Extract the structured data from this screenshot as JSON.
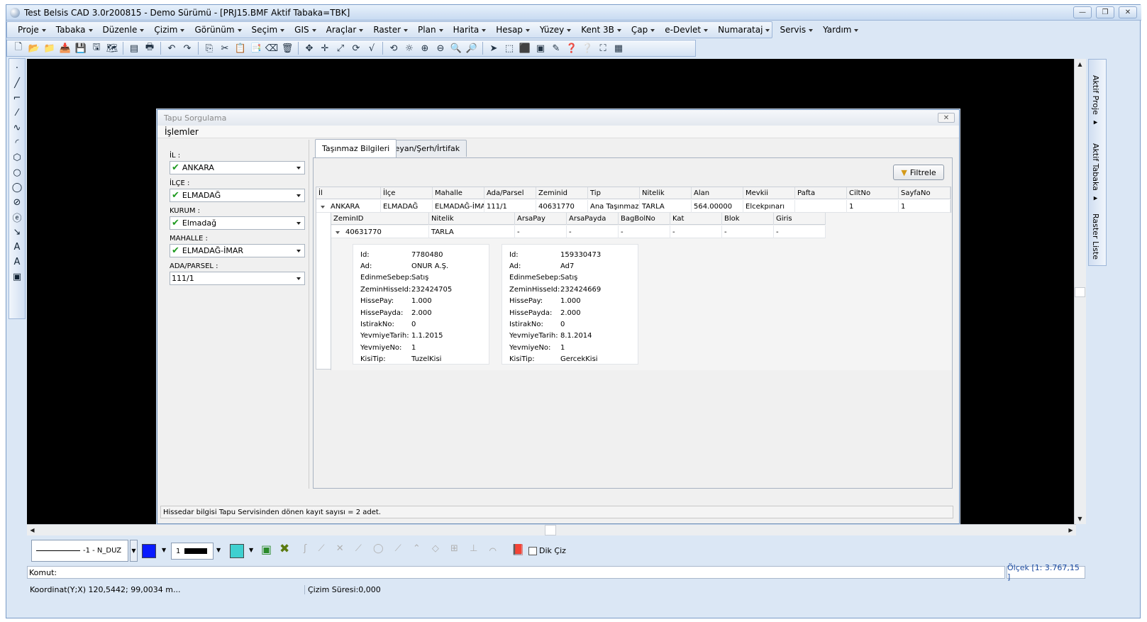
{
  "window": {
    "title": "Test Belsis CAD 3.0r200815 - Demo Sürümü - [PRJ15.BMF  Aktif Tabaka=TBK]"
  },
  "menubar": [
    "Proje",
    "Tabaka",
    "Düzenle",
    "Çizim",
    "Görünüm",
    "Seçim",
    "GIS",
    "Araçlar",
    "Raster",
    "Plan",
    "Harita",
    "Hesap",
    "Yüzey",
    "Kent 3B",
    "Çap",
    "e-Devlet",
    "Numarataj",
    "Servis",
    "Yardım"
  ],
  "right_panel": {
    "aktif_proje": "Aktif Proje ▸",
    "aktif_tabaka": "Aktif Tabaka ▸",
    "raster_liste": "Raster Liste"
  },
  "dialog": {
    "title": "Tapu Sorgulama",
    "menu": "İşlemler",
    "filters": {
      "il_label": "İL :",
      "il_value": "ANKARA",
      "ilce_label": "İLÇE :",
      "ilce_value": "ELMADAĞ",
      "kurum_label": "KURUM :",
      "kurum_value": "Elmadağ",
      "mahalle_label": "MAHALLE :",
      "mahalle_value": "ELMADAĞ-İMAR",
      "adaparsel_label": "ADA/PARSEL :",
      "adaparsel_value": "111/1"
    },
    "tabs": {
      "tab1": "Taşınmaz Bilgileri",
      "tab2": "Beyan/Şerh/İrtifak"
    },
    "filter_button": "Filtrele",
    "grid_headers": [
      "İl",
      "İlçe",
      "Mahalle",
      "Ada/Parsel",
      "Zeminid",
      "Tip",
      "Nitelik",
      "Alan",
      "Mevkii",
      "Pafta",
      "CiltNo",
      "SayfaNo"
    ],
    "grid_row": [
      "ANKARA",
      "ELMADAĞ",
      "ELMADAĞ-İMA",
      "111/1",
      "40631770",
      "Ana Taşınmaz",
      "TARLA",
      "564.00000",
      "Elcekpınarı",
      "",
      "1",
      "1"
    ],
    "sub_headers": [
      "ZeminID",
      "Nitelik",
      "ArsaPay",
      "ArsaPayda",
      "BagBolNo",
      "Kat",
      "Blok",
      "Giris"
    ],
    "sub_row": [
      "40631770",
      "TARLA",
      "-",
      "-",
      "-",
      "-",
      "-",
      "-"
    ],
    "cards": [
      {
        "rows": [
          [
            "Id:",
            "7780480"
          ],
          [
            "Ad:",
            "ONUR A.Ş."
          ],
          [
            "EdinmeSebep:",
            "Satış"
          ],
          [
            "ZeminHisseId:",
            "232424705"
          ],
          [
            "HissePay:",
            "1.000"
          ],
          [
            "HissePayda:",
            "2.000"
          ],
          [
            "IstirakNo:",
            "0"
          ],
          [
            "YevmiyeTarih:",
            "1.1.2015"
          ],
          [
            "YevmiyeNo:",
            "1"
          ],
          [
            "KisiTip:",
            "TuzelKisi"
          ]
        ]
      },
      {
        "rows": [
          [
            "Id:",
            "159330473"
          ],
          [
            "Ad:",
            "Ad7"
          ],
          [
            "EdinmeSebep:",
            "Satış"
          ],
          [
            "ZeminHisseId:",
            "232424669"
          ],
          [
            "HissePay:",
            "1.000"
          ],
          [
            "HissePayda:",
            "2.000"
          ],
          [
            "IstirakNo:",
            "0"
          ],
          [
            "YevmiyeTarih:",
            "8.1.2014"
          ],
          [
            "YevmiyeNo:",
            "1"
          ],
          [
            "KisiTip:",
            "GercekKisi"
          ]
        ]
      }
    ],
    "status": "Hissedar bilgisi Tapu Servisinden dönen kayıt sayısı = 2 adet."
  },
  "bottom": {
    "linetype": "-1 - N_DUZ",
    "linewidth": "1",
    "dik_ciz": "Dik Çiz",
    "color1": "#0a1bff",
    "color2": "#3fd0d0"
  },
  "command": {
    "label": "Komut:",
    "scale": "Ölçek [1: 3.767,15 ]"
  },
  "statusbar": {
    "coord": "Koordinat(Y;X)  120,5442; 99,0034 m...",
    "time": "Çizim Süresi:0,000"
  }
}
